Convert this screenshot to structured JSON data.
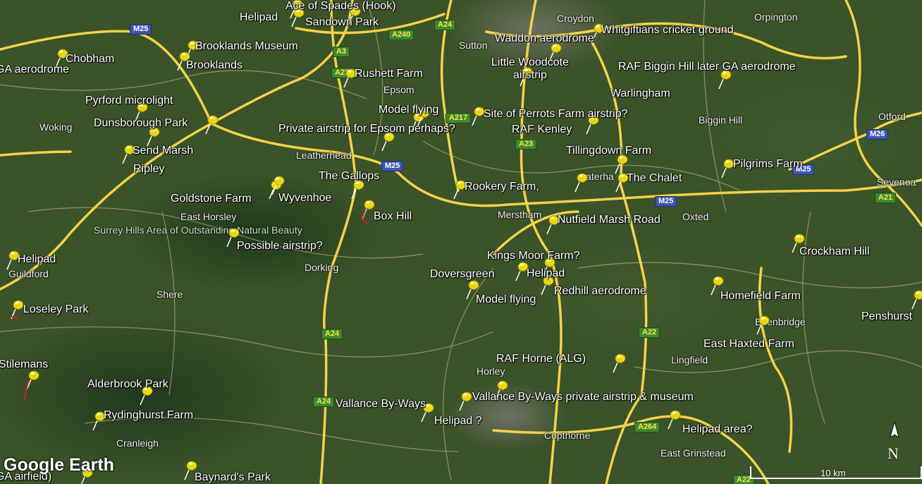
{
  "app": "Google Earth",
  "map_view": {
    "logo": "Google Earth",
    "scale_label": "10 km",
    "north_label": "N"
  },
  "places": {
    "p0": "Helipad",
    "p1": "Ace of Spades (Hook)",
    "p2": "Sandown Park",
    "p3": "Chobham",
    "p4": "GA aerodrome",
    "p5": "Brooklands Museum",
    "p6": "Brooklands",
    "p7": "Rushett Farm",
    "p8": "Pyrford microlight",
    "p9": "Dunsborough Park",
    "p10": "Model flying",
    "p11": "Private airstrip for Epsom perhaps?",
    "p12": "Send Marsh",
    "p13": "Ripley",
    "p14": "The Gallops",
    "p15": "Goldstone Farm",
    "p16": "Wyvenhoe",
    "p17": "Box Hill",
    "p18": "Possible airstrip?",
    "p19": "Helipad",
    "p20": "Loseley Park",
    "p21": "Stilemans",
    "p22": "Alderbrook Park",
    "p23": "Rydinghurst Farm",
    "p24": "GA airfield)",
    "p25": "Baynard's Park",
    "p26": "Waddon aerodrome",
    "p27": "Whitgiftians cricket ground",
    "p28": "Little Woodcote airstrip",
    "p29": "RAF Biggin Hill later GA aerodrome",
    "p30": "Warlingham",
    "p31": "Site of Perrots Farm airstrip?",
    "p32": "RAF Kenley",
    "p33": "Tillingdown Farm",
    "p34": "Pilgrims Farm",
    "p35": "The Chalet",
    "p36": "Rookery Farm,",
    "p37": "Nutfield Marsh Road",
    "p38": "Kings Moor Farm?",
    "p39": "Doversgreen",
    "p40": "Helipad",
    "p41": "Redhill aerodrome",
    "p42": "Model flying",
    "p43": "Crockham Hill",
    "p44": "Homefield Farm",
    "p45": "Penshurst",
    "p46": "East Haxted Farm",
    "p47": "RAF Horne (ALG)",
    "p48": "Vallance By-Ways",
    "p49": "Vallance By-Ways private airstrip & museum",
    "p50": "Helipad ?",
    "p51": "Helipad area?"
  },
  "towns": {
    "t0": "Croydon",
    "t1": "Orpington",
    "t2": "Sutton",
    "t3": "Epsom",
    "t4": "Woking",
    "t5": "Leatherhead",
    "t6": "Biggin Hill",
    "t7": "Otford",
    "t8": "Sevenoa",
    "t9": "Caterha",
    "t10": "Oxted",
    "t11": "Merstham",
    "t12": "East Horsley",
    "t13": "Guildford",
    "t14": "Dorking",
    "t15": "Shere",
    "t16": "Edenbridge",
    "t17": "Horley",
    "t18": "Lingfield",
    "t19": "Cranleigh",
    "t20": "Copthorne",
    "t21": "East Grinstead"
  },
  "aonb_label": "Surrey Hills Area of Outstanding Natural Beauty",
  "road_shields": {
    "r0": "M25",
    "r1": "A240",
    "r2": "A24",
    "r3": "A3",
    "r4": "A217",
    "r5": "A23",
    "r6": "M25",
    "r7": "M26",
    "r8": "M25",
    "r9": "A21",
    "r10": "A24",
    "r11": "A22",
    "r12": "A24",
    "r13": "A264",
    "r14": "A22",
    "r15": "A217",
    "r16": "M25"
  },
  "pin_count": 53,
  "colors": {
    "pin": "#f2e018",
    "road_major": "#f3d34a",
    "road_minor": "#d8c98a",
    "terrain": "#3a5329"
  }
}
